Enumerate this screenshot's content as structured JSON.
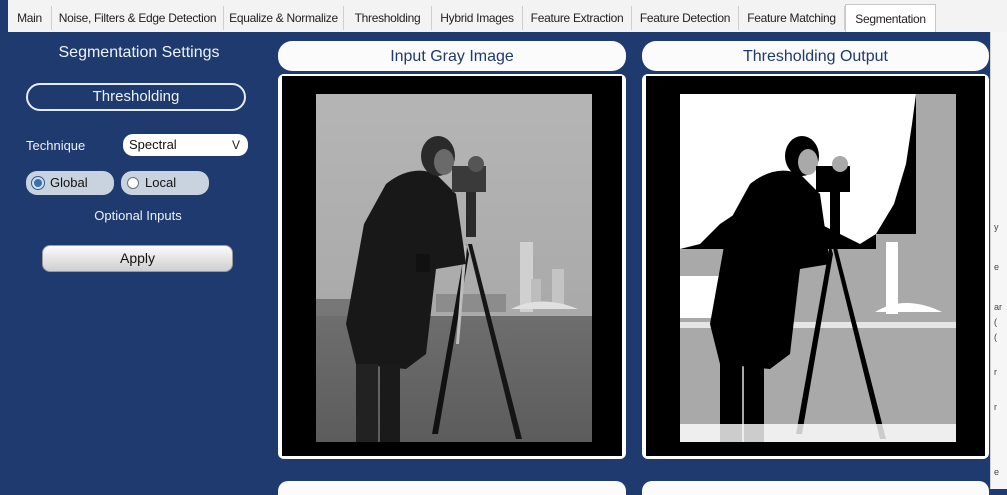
{
  "tabs": [
    {
      "label": "Main",
      "active": false
    },
    {
      "label": "Noise, Filters & Edge Detection",
      "active": false
    },
    {
      "label": "Equalize & Normalize",
      "active": false
    },
    {
      "label": "Thresholding",
      "active": false
    },
    {
      "label": "Hybrid Images",
      "active": false
    },
    {
      "label": "Feature Extraction",
      "active": false
    },
    {
      "label": "Feature Detection",
      "active": false
    },
    {
      "label": "Feature Matching",
      "active": false
    },
    {
      "label": "Segmentation",
      "active": true
    }
  ],
  "settings": {
    "title": "Segmentation Settings",
    "mode": "Thresholding",
    "technique_label": "Technique",
    "technique_value": "Spectral",
    "technique_chevron": "V",
    "radio_global": "Global",
    "radio_local": "Local",
    "selected_radio": "Global",
    "optional_label": "Optional Inputs",
    "apply_label": "Apply"
  },
  "panels": {
    "input_title": "Input Gray Image",
    "output_title": "Thresholding Output"
  },
  "colors": {
    "background": "#1e3a6e",
    "title_text": "#1e3a6e"
  }
}
